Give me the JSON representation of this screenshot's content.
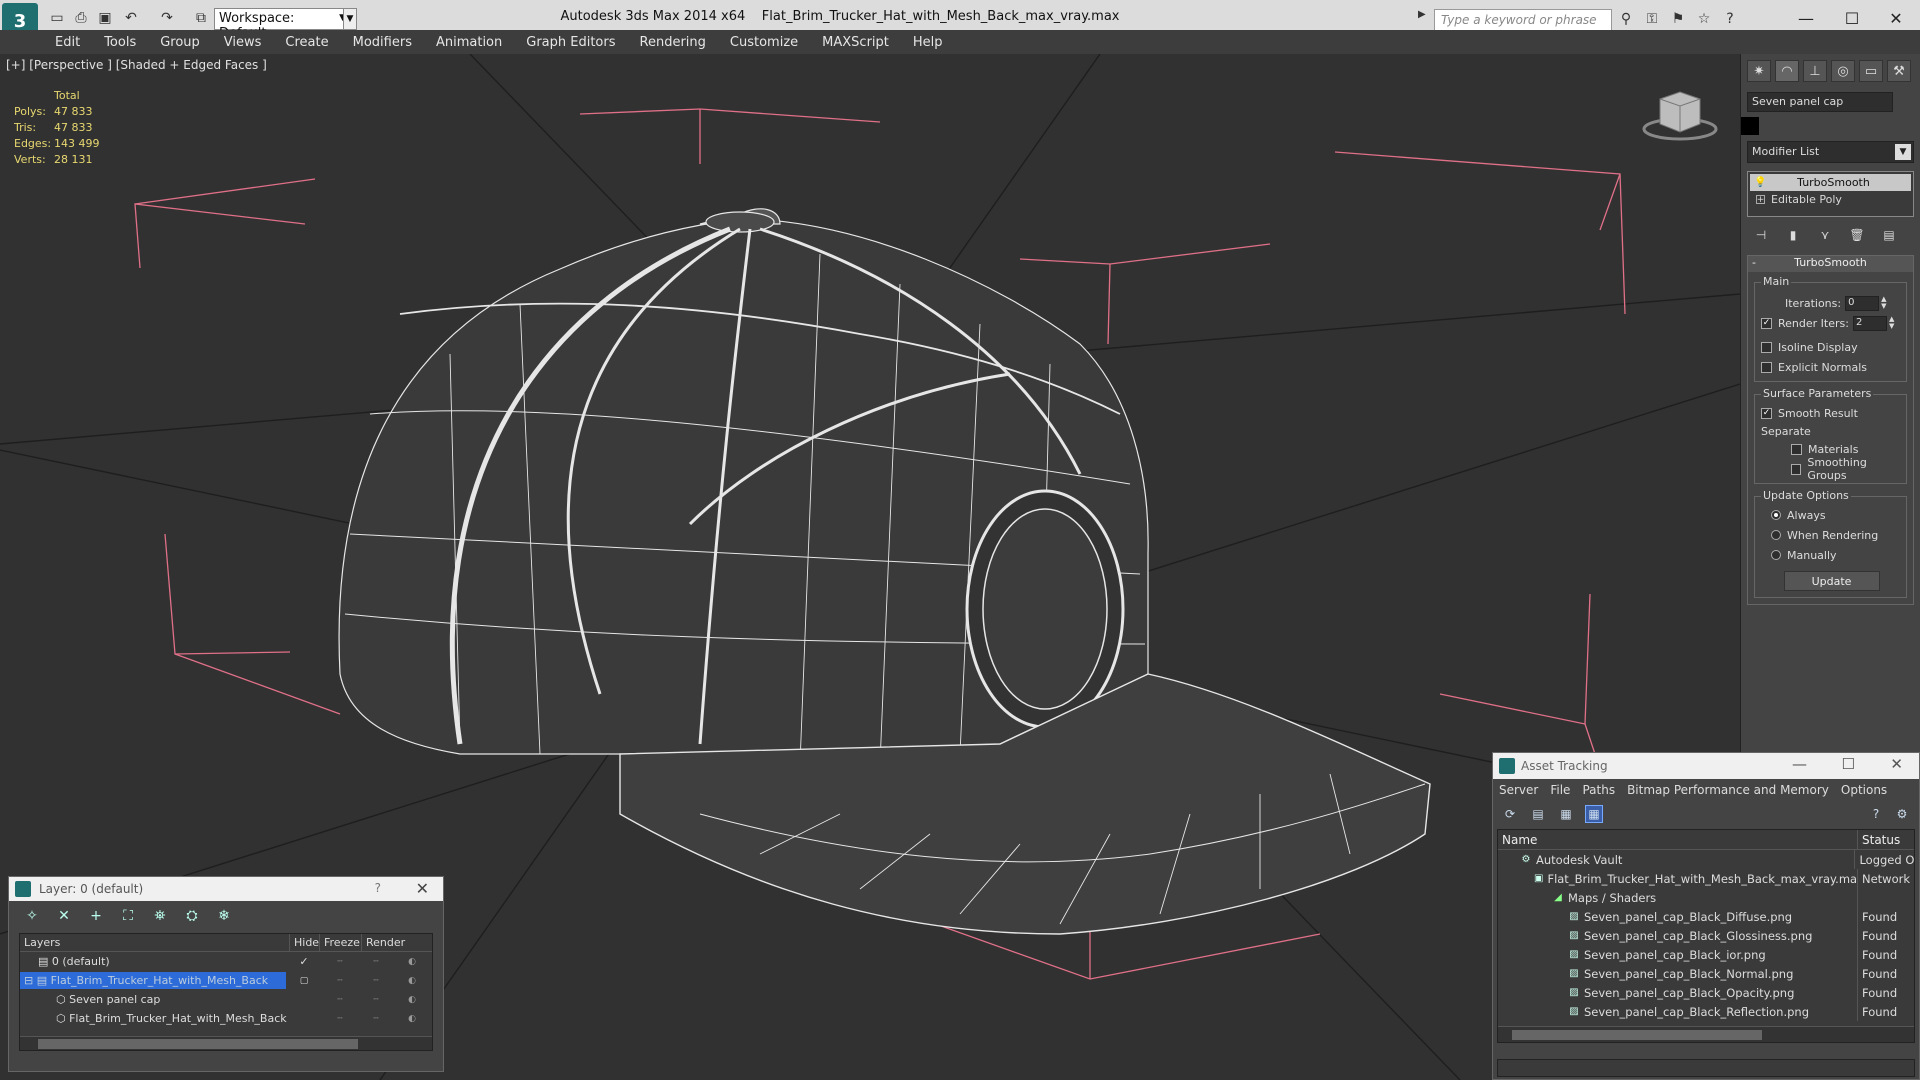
{
  "titlebar": {
    "workspace": "Workspace: Default",
    "app_name": "Autodesk 3ds Max  2014 x64",
    "file_name": "Flat_Brim_Trucker_Hat_with_Mesh_Back_max_vray.max",
    "search_placeholder": "Type a keyword or phrase"
  },
  "menu": [
    "Edit",
    "Tools",
    "Group",
    "Views",
    "Create",
    "Modifiers",
    "Animation",
    "Graph Editors",
    "Rendering",
    "Customize",
    "MAXScript",
    "Help"
  ],
  "viewport": {
    "label": "[+] [Perspective ] [Shaded + Edged Faces ]",
    "stats": {
      "header": "Total",
      "rows": [
        {
          "key": "Polys:",
          "value": "47 833"
        },
        {
          "key": "Tris:",
          "value": "47 833"
        },
        {
          "key": "Edges:",
          "value": "143 499"
        },
        {
          "key": "Verts:",
          "value": "28 131"
        }
      ]
    }
  },
  "command_panel": {
    "object_name": "Seven panel cap",
    "modifier_list": "Modifier List",
    "stack": [
      "TurboSmooth",
      "Editable Poly"
    ],
    "rollout": "TurboSmooth",
    "main": {
      "title": "Main",
      "iterations_label": "Iterations:",
      "iterations_value": "0",
      "render_iters_label": "Render Iters:",
      "render_iters_value": "2",
      "isoline": "Isoline Display",
      "explicit": "Explicit Normals"
    },
    "surface": {
      "title": "Surface Parameters",
      "smooth_result": "Smooth Result",
      "separate": "Separate",
      "materials": "Materials",
      "smoothing_groups": "Smoothing Groups"
    },
    "update_options": {
      "title": "Update Options",
      "always": "Always",
      "when_rendering": "When Rendering",
      "manually": "Manually",
      "update_button": "Update"
    }
  },
  "layer_window": {
    "title": "Layer: 0 (default)",
    "help": "?",
    "columns": [
      "Layers",
      "Hide",
      "Freeze",
      "Render"
    ],
    "rows": [
      {
        "name": "0 (default)"
      },
      {
        "name": "Flat_Brim_Trucker_Hat_with_Mesh_Back"
      },
      {
        "name": "Seven panel cap"
      },
      {
        "name": "Flat_Brim_Trucker_Hat_with_Mesh_Back"
      }
    ]
  },
  "asset_window": {
    "title": "Asset Tracking",
    "menu": [
      "Server",
      "File",
      "Paths",
      "Bitmap Performance and Memory",
      "Options"
    ],
    "columns": [
      "Name",
      "Status"
    ],
    "rows": [
      {
        "name": "Autodesk Vault",
        "status": "Logged O"
      },
      {
        "name": "Flat_Brim_Trucker_Hat_with_Mesh_Back_max_vray.max",
        "status": "Network"
      },
      {
        "name": "Maps / Shaders",
        "status": ""
      },
      {
        "name": "Seven_panel_cap_Black_Diffuse.png",
        "status": "Found"
      },
      {
        "name": "Seven_panel_cap_Black_Glossiness.png",
        "status": "Found"
      },
      {
        "name": "Seven_panel_cap_Black_ior.png",
        "status": "Found"
      },
      {
        "name": "Seven_panel_cap_Black_Normal.png",
        "status": "Found"
      },
      {
        "name": "Seven_panel_cap_Black_Opacity.png",
        "status": "Found"
      },
      {
        "name": "Seven_panel_cap_Black_Reflection.png",
        "status": "Found"
      }
    ]
  },
  "colors": {
    "stats_text": "#e8d870",
    "selection_blue": "#2d6bd9",
    "bbox_pink": "#e07088"
  }
}
